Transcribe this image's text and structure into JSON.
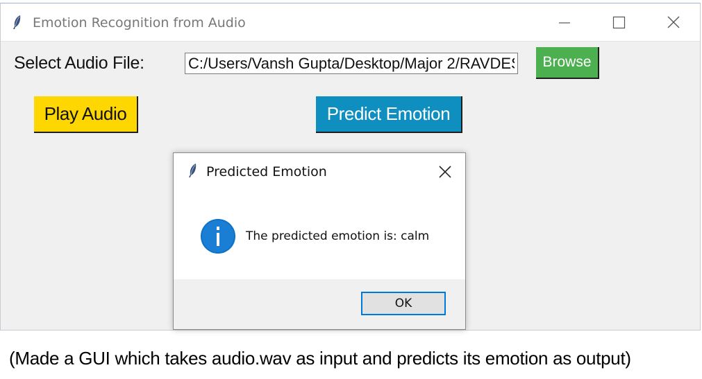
{
  "window": {
    "title": "Emotion Recognition from Audio",
    "controls": {
      "minimize": "minimize-icon",
      "maximize": "maximize-icon",
      "close": "close-icon"
    }
  },
  "form": {
    "select_label": "Select Audio File:",
    "file_path": "C:/Users/Vansh Gupta/Desktop/Major 2/RAVDES",
    "browse_label": "Browse",
    "play_label": "Play Audio",
    "predict_label": "Predict Emotion"
  },
  "dialog": {
    "title": "Predicted Emotion",
    "message": "The predicted emotion is: calm",
    "ok_label": "OK",
    "icon": "info-icon"
  },
  "caption": "(Made a GUI which takes audio.wav as input and predicts its emotion as output)",
  "colors": {
    "browse": "#4caf50",
    "play": "#ffd700",
    "predict": "#0e8fbf",
    "info": "#0078d7"
  }
}
